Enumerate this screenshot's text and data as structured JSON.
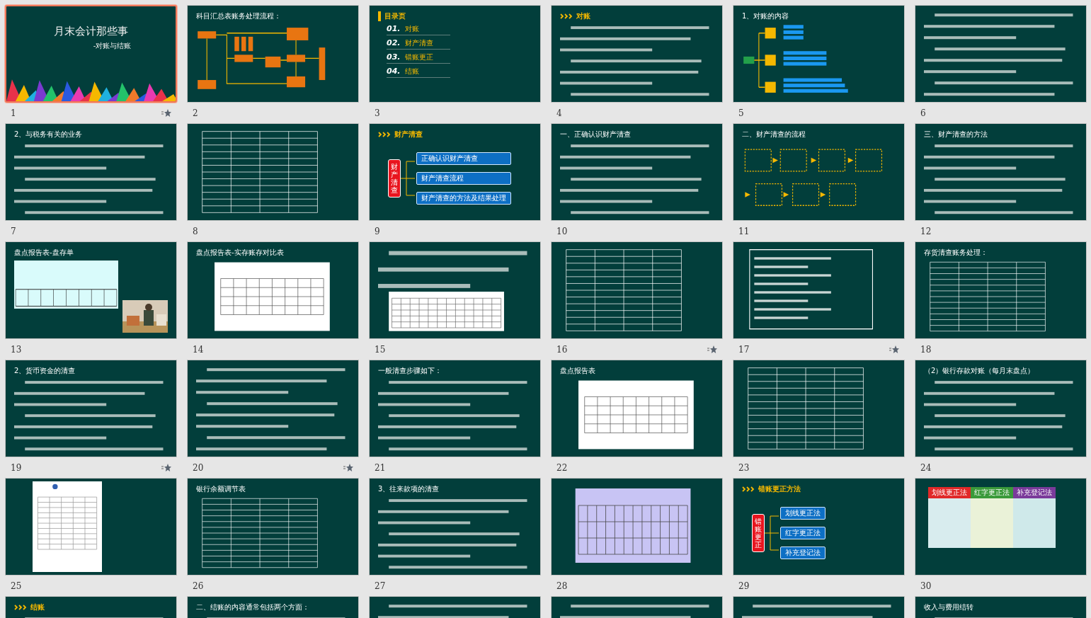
{
  "slides": [
    {
      "number": "1",
      "kind": "cover",
      "selected": true,
      "animated": true,
      "title": "月末会计那些事",
      "subtitle": "-对账与结账"
    },
    {
      "number": "2",
      "kind": "flowchart",
      "selected": false,
      "animated": false,
      "heading": "科目汇总表账务处理流程："
    },
    {
      "number": "3",
      "kind": "toc",
      "selected": false,
      "animated": false,
      "heading": "目录页",
      "items": [
        {
          "number": "01.",
          "label": "对账"
        },
        {
          "number": "02.",
          "label": "财产清查"
        },
        {
          "number": "03.",
          "label": "错账更正"
        },
        {
          "number": "04.",
          "label": "结账"
        }
      ]
    },
    {
      "number": "4",
      "kind": "text",
      "selected": false,
      "animated": false,
      "chevrons": true,
      "heading": "对账"
    },
    {
      "number": "5",
      "kind": "mindmap",
      "selected": false,
      "animated": false,
      "heading": "1、对账的内容"
    },
    {
      "number": "6",
      "kind": "text",
      "selected": false,
      "animated": false
    },
    {
      "number": "7",
      "kind": "text",
      "selected": false,
      "animated": false,
      "heading": "2、与税务有关的业务"
    },
    {
      "number": "8",
      "kind": "table",
      "selected": false,
      "animated": false
    },
    {
      "number": "9",
      "kind": "branch",
      "selected": false,
      "animated": false,
      "chevrons": true,
      "heading": "财产清查",
      "root": "财产清查",
      "items": [
        {
          "label": "正确认识财产清查"
        },
        {
          "label": "财产清查流程"
        },
        {
          "label": "财产清查的方法及结果处理"
        }
      ]
    },
    {
      "number": "10",
      "kind": "text",
      "selected": false,
      "animated": false,
      "heading": "一、正确认识财产清查"
    },
    {
      "number": "11",
      "kind": "flow",
      "selected": false,
      "animated": false,
      "heading": "二、财产清查的流程"
    },
    {
      "number": "12",
      "kind": "text",
      "selected": false,
      "animated": false,
      "heading": "三、财产清查的方法"
    },
    {
      "number": "13",
      "kind": "form-photo",
      "selected": false,
      "animated": false,
      "heading": "盘点报告表-盘存单"
    },
    {
      "number": "14",
      "kind": "form",
      "selected": false,
      "animated": false,
      "heading": "盘点报告表-实存账存对比表"
    },
    {
      "number": "15",
      "kind": "text-form",
      "selected": false,
      "animated": false
    },
    {
      "number": "16",
      "kind": "table",
      "selected": false,
      "animated": true
    },
    {
      "number": "17",
      "kind": "box",
      "selected": false,
      "animated": true
    },
    {
      "number": "18",
      "kind": "table",
      "selected": false,
      "animated": false,
      "heading": "存货清查账务处理："
    },
    {
      "number": "19",
      "kind": "text",
      "selected": false,
      "animated": true,
      "heading": "2、货币资金的清查"
    },
    {
      "number": "20",
      "kind": "text",
      "selected": false,
      "animated": true
    },
    {
      "number": "21",
      "kind": "text",
      "selected": false,
      "animated": false,
      "heading": "一般清查步骤如下："
    },
    {
      "number": "22",
      "kind": "form",
      "selected": false,
      "animated": false,
      "heading": "盘点报告表"
    },
    {
      "number": "23",
      "kind": "table",
      "selected": false,
      "animated": false
    },
    {
      "number": "24",
      "kind": "text",
      "selected": false,
      "animated": false,
      "heading": "（2）银行存款对账（每月末盘点）"
    },
    {
      "number": "25",
      "kind": "document",
      "selected": false,
      "animated": false
    },
    {
      "number": "26",
      "kind": "table",
      "selected": false,
      "animated": false,
      "heading": "银行余额调节表"
    },
    {
      "number": "27",
      "kind": "text",
      "selected": false,
      "animated": false,
      "heading": "3、往来款项的清查"
    },
    {
      "number": "28",
      "kind": "purple-form",
      "selected": false,
      "animated": false
    },
    {
      "number": "29",
      "kind": "branch",
      "selected": false,
      "animated": false,
      "chevrons": true,
      "heading": "错账更正方法",
      "root": "错账更正",
      "items": [
        {
          "label": "划线更正法"
        },
        {
          "label": "红字更正法"
        },
        {
          "label": "补充登记法"
        }
      ]
    },
    {
      "number": "30",
      "kind": "columns",
      "selected": false,
      "animated": false,
      "items": [
        {
          "label": "划线更正法",
          "color": "#e02828"
        },
        {
          "label": "红字更正法",
          "color": "#3a9a3a"
        },
        {
          "label": "补充登记法",
          "color": "#7a3a9a"
        }
      ]
    },
    {
      "kind": "text",
      "selected": false,
      "chevrons": true,
      "heading": "结账"
    },
    {
      "kind": "text",
      "selected": false,
      "heading": "二、结账的内容通常包括两个方面："
    },
    {
      "kind": "text",
      "selected": false
    },
    {
      "kind": "text",
      "selected": false
    },
    {
      "kind": "text",
      "selected": false
    },
    {
      "kind": "text",
      "selected": false,
      "heading": "收入与费用结转"
    }
  ]
}
